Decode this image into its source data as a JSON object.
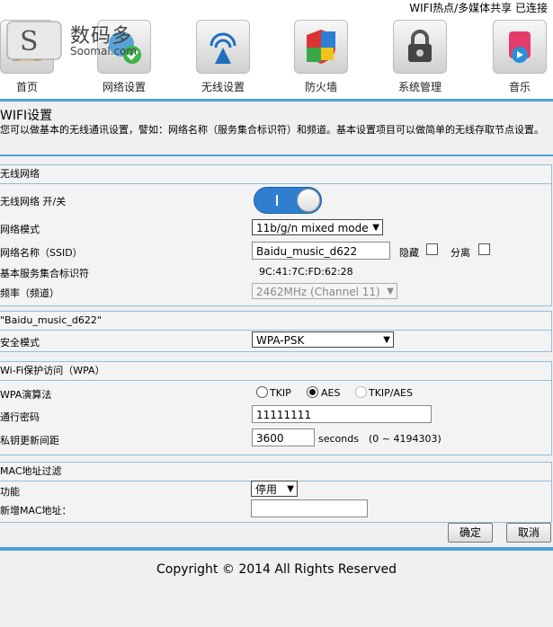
{
  "header": {
    "status": "WIFI热点/多媒体共享  已连接"
  },
  "logo": {
    "cn": "数码多",
    "en": "Soomal.com"
  },
  "nav": [
    {
      "label": "首页",
      "icon": "home-icon"
    },
    {
      "label": "网络设置",
      "icon": "network-icon"
    },
    {
      "label": "无线设置",
      "icon": "wireless-icon"
    },
    {
      "label": "防火墙",
      "icon": "firewall-shield-icon"
    },
    {
      "label": "系统管理",
      "icon": "lock-gear-icon"
    },
    {
      "label": "音乐",
      "icon": "music-icon"
    }
  ],
  "page": {
    "title": "WIFI设置",
    "description": "您可以做基本的无线通讯设置，譬如：网络名称（服务集合标识符）和频道。基本设置项目可以做简单的无线存取节点设置。"
  },
  "wireless": {
    "section_title": "无线网络",
    "onoff_label": "无线网络 开/关",
    "onoff_state": "I",
    "mode_label": "网络模式",
    "mode_value": "11b/g/n mixed mode",
    "ssid_label": "网络名称（SSID）",
    "ssid_value": "Baidu_music_d622",
    "hidden_label": "隐藏",
    "isolate_label": "分离",
    "bssid_label": "基本服务集合标识符",
    "bssid_value": "9C:41:7C:FD:62:28",
    "channel_label": "频率（频道）",
    "channel_value": "2462MHz (Channel 11)"
  },
  "security": {
    "section_title": "\"Baidu_music_d622\"",
    "mode_label": "安全模式",
    "mode_value": "WPA-PSK"
  },
  "wpa": {
    "section_title": "Wi-Fi保护访问（WPA）",
    "algo_label": "WPA演算法",
    "opt_tkip": "TKIP",
    "opt_aes": "AES",
    "opt_tkipaes": "TKIP/AES",
    "selected": "AES",
    "key_label": "通行密码",
    "key_value": "11111111",
    "renew_label": "私钥更新间距",
    "renew_value": "3600",
    "renew_unit": "seconds",
    "renew_range": "(0 ~ 4194303)"
  },
  "mac": {
    "section_title": "MAC地址过滤",
    "func_label": "功能",
    "func_value": "停用",
    "new_label": "新增MAC地址：",
    "new_value": ""
  },
  "buttons": {
    "ok": "确定",
    "cancel": "取消"
  },
  "footer": {
    "copyright": "Copyright © 2014 All Rights Reserved"
  },
  "colors": {
    "accent": "#4aa0d8",
    "toggle": "#2f7ed0"
  }
}
